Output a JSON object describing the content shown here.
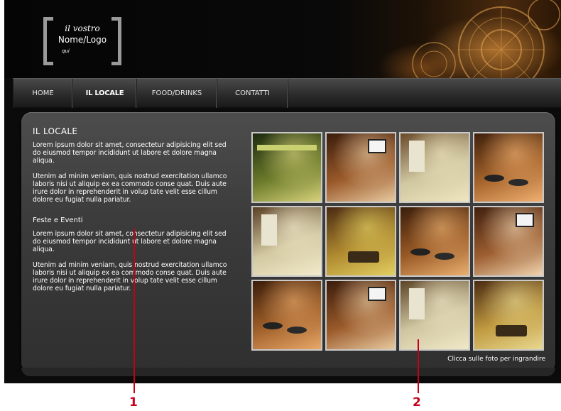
{
  "logo": {
    "line1": "il vostro",
    "line2": "Nome/Logo",
    "line3": "qui"
  },
  "nav": {
    "items": [
      {
        "label": "HOME",
        "active": false
      },
      {
        "label": "IL LOCALE",
        "active": true
      },
      {
        "label": "FOOD/DRINKS",
        "active": false
      },
      {
        "label": "CONTATTI",
        "active": false
      }
    ]
  },
  "content": {
    "title": "IL LOCALE",
    "para1": "Lorem ipsum dolor sit amet, consectetur adipisicing elit sed do eiusmod tempor incididunt ut labore et dolore magna aliqua.",
    "para2": "Utenim ad minim veniam, quis nostrud exercitation ullamco laboris nisi ut aliquip ex ea commodo conse quat. Duis aute irure dolor in reprehenderit in volup tate velit esse cillum dolore eu fugiat nulla pariatur.",
    "events_title": "Feste e Eventi",
    "para3": "Lorem ipsum dolor sit amet, consectetur adipisicing elit sed do eiusmod tempor incididunt ut labore et dolore magna aliqua.",
    "para4": "Utenim ad minim veniam, quis nostrud exercitation ullamco laboris nisi ut aliquip ex ea commodo conse quat. Duis aute irure dolor in reprehenderit in volup tate velit esse cillum dolore eu fugiat nulla pariatur."
  },
  "gallery": {
    "caption": "Clicca sulle foto per ingrandire",
    "photos": [
      {
        "scene": "storefront-night",
        "colors": [
          "#1d2a10",
          "#6b7a2a",
          "#d7d27a"
        ]
      },
      {
        "scene": "bar-tv",
        "colors": [
          "#3a1c0c",
          "#9a5a2a",
          "#e8c9a0"
        ]
      },
      {
        "scene": "dining-bright",
        "colors": [
          "#6a4a2a",
          "#cfc7a0",
          "#efe6c0"
        ]
      },
      {
        "scene": "bar-stools",
        "colors": [
          "#3e200c",
          "#a6642c",
          "#f0b070"
        ]
      },
      {
        "scene": "dining-bright",
        "colors": [
          "#5a4026",
          "#d2c8a0",
          "#f2eacc"
        ]
      },
      {
        "scene": "tables-yellow",
        "colors": [
          "#4a2a12",
          "#b08a30",
          "#e2cf60"
        ]
      },
      {
        "scene": "bar-stools",
        "colors": [
          "#3a1e0c",
          "#9a5a26",
          "#eab070"
        ]
      },
      {
        "scene": "bar-tv",
        "colors": [
          "#402010",
          "#9c5e30",
          "#f0d4b0"
        ]
      },
      {
        "scene": "bar-stools",
        "colors": [
          "#3a1c0a",
          "#a0602a",
          "#e8a868"
        ]
      },
      {
        "scene": "bar-tv",
        "colors": [
          "#3a1c0c",
          "#9a5a2a",
          "#e8c9a0"
        ]
      },
      {
        "scene": "dining-bright",
        "colors": [
          "#5c4428",
          "#d0c6a0",
          "#f0e8c8"
        ]
      },
      {
        "scene": "tables-yellow",
        "colors": [
          "#4a2a12",
          "#c09a40",
          "#e8d890"
        ]
      }
    ]
  },
  "annotations": [
    {
      "label": "1"
    },
    {
      "label": "2"
    }
  ],
  "colors": {
    "annotation": "#c4001a",
    "panel": "#3c3c3c",
    "background": "#0b0b0b"
  }
}
